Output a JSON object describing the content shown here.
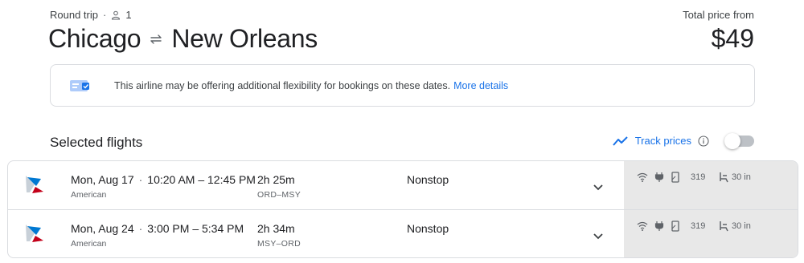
{
  "header": {
    "trip_type": "Round trip",
    "passengers": "1",
    "origin": "Chicago",
    "destination": "New Orleans",
    "total_price_label": "Total price from",
    "total_price": "$49"
  },
  "notice": {
    "text": "This airline may be offering additional flexibility for bookings on these dates.",
    "link": "More details"
  },
  "selected_flights": {
    "title": "Selected flights",
    "track_prices_label": "Track prices",
    "track_prices_on": false
  },
  "flights": [
    {
      "date": "Mon, Aug 17",
      "times": "10:20 AM – 12:45 PM",
      "airline": "American",
      "duration": "2h 25m",
      "airports": "ORD–MSY",
      "stops": "Nonstop",
      "co2": "319",
      "legroom": "30 in"
    },
    {
      "date": "Mon, Aug 24",
      "times": "3:00 PM – 5:34 PM",
      "airline": "American",
      "duration": "2h 34m",
      "airports": "MSY–ORD",
      "stops": "Nonstop",
      "co2": "319",
      "legroom": "30 in"
    }
  ],
  "colors": {
    "link": "#1a73e8",
    "amenities_bg": "#e8e8e8",
    "border": "#dadce0"
  },
  "icons": [
    "person-icon",
    "swap-arrows-icon",
    "ticket-icon",
    "trend-chart-icon",
    "info-icon",
    "american-airlines-logo",
    "chevron-down-icon",
    "wifi-icon",
    "power-plug-icon",
    "screen-icon",
    "seat-icon"
  ]
}
